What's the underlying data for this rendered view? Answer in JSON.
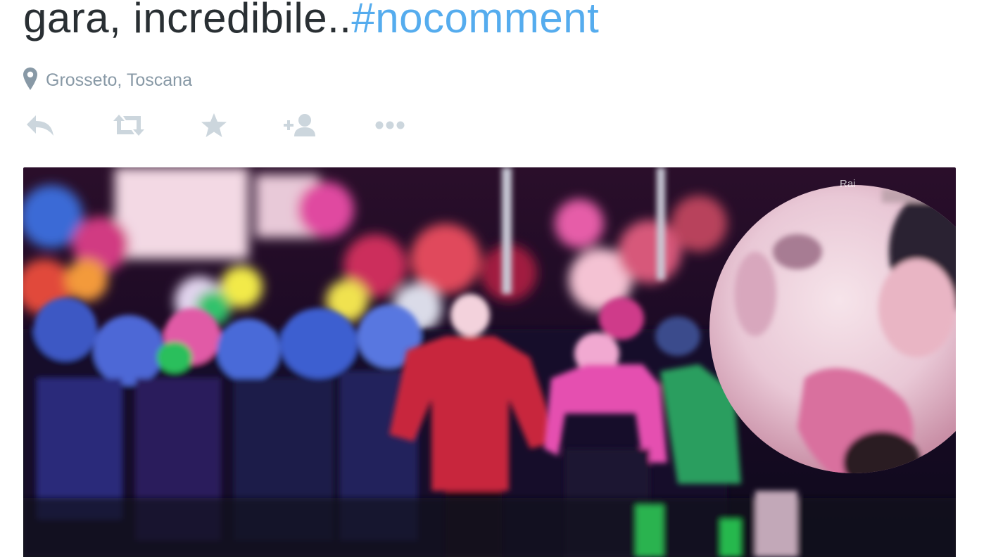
{
  "tweet": {
    "text_prefix": "gara, incredibile..",
    "hashtag": "#nocomment",
    "location": "Grosseto, Toscana"
  },
  "icons": {
    "location": "map-pin-icon",
    "reply": "reply-icon",
    "retweet": "retweet-icon",
    "favorite": "star-icon",
    "follow": "follow-icon",
    "more": "more-icon"
  },
  "media": {
    "overlay_text": "Rai"
  },
  "colors": {
    "text": "#292f33",
    "hashtag": "#55acee",
    "muted": "#8899a6",
    "icon": "#ccd6dd"
  }
}
